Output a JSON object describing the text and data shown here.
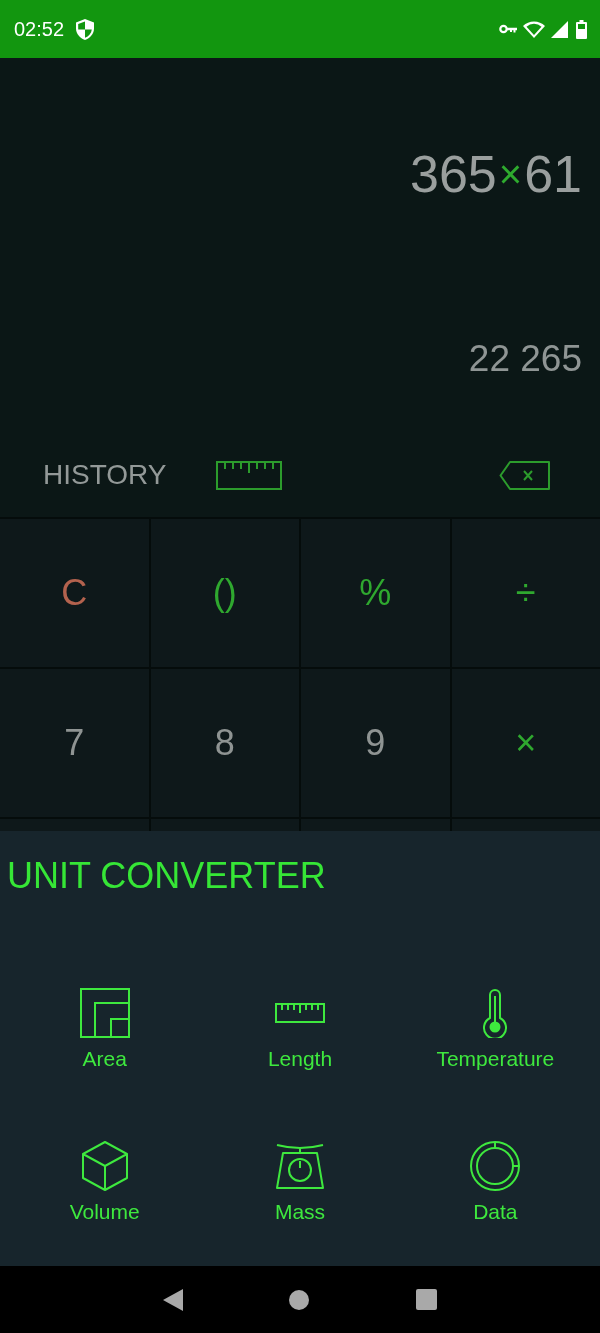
{
  "status_bar": {
    "time": "02:52"
  },
  "display": {
    "expression": [
      {
        "text": "365",
        "kind": "number"
      },
      {
        "text": "×",
        "kind": "operator"
      },
      {
        "text": "61",
        "kind": "number"
      }
    ],
    "result": "22 265"
  },
  "toolbar": {
    "history_label": "HISTORY"
  },
  "keypad": {
    "keys": [
      {
        "label": "C",
        "kind": "clear"
      },
      {
        "label": "()",
        "kind": "operator"
      },
      {
        "label": "%",
        "kind": "operator"
      },
      {
        "label": "÷",
        "kind": "operator"
      },
      {
        "label": "7",
        "kind": "digit"
      },
      {
        "label": "8",
        "kind": "digit"
      },
      {
        "label": "9",
        "kind": "digit"
      },
      {
        "label": "×",
        "kind": "operator"
      }
    ]
  },
  "unit_converter": {
    "title": "UNIT CONVERTER",
    "items": [
      {
        "label": "Area",
        "kind": "area"
      },
      {
        "label": "Length",
        "kind": "length"
      },
      {
        "label": "Temperature",
        "kind": "temperature"
      },
      {
        "label": "Volume",
        "kind": "volume"
      },
      {
        "label": "Mass",
        "kind": "mass"
      },
      {
        "label": "Data",
        "kind": "data"
      }
    ]
  }
}
